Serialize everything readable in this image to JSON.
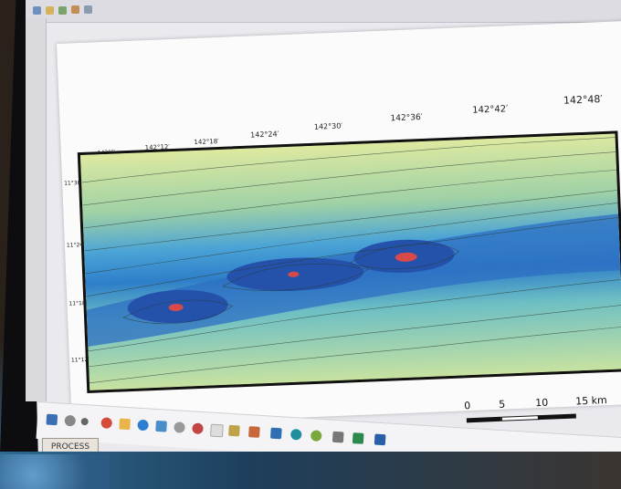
{
  "longitude_labels": [
    "142°6′",
    "142°12′",
    "142°18′",
    "142°24′",
    "142°30′",
    "142°36′",
    "142°42′",
    "142°48′"
  ],
  "latitude_labels": [
    "11°30′",
    "11°24′",
    "11°18′",
    "11°12′"
  ],
  "scale_bar": {
    "ticks": [
      "0",
      "5",
      "10",
      "15 km"
    ]
  },
  "label_text": "PROCESS",
  "colors": {
    "map_low": "#1f56b0",
    "map_mid": "#2f86d0",
    "map_high": "#d7e9a3",
    "hotspot": "#d84a4a"
  },
  "icons": [
    "save-icon",
    "folder-icon",
    "cursor-icon",
    "layers-icon",
    "pan-icon",
    "start-icon",
    "search-icon",
    "task-view-icon",
    "chrome-icon",
    "folder-icon",
    "browser-icon",
    "cloud-icon",
    "network-icon",
    "document-icon",
    "app-icon",
    "mail-icon",
    "map-app-icon",
    "qgis-icon",
    "files-icon",
    "excel-icon",
    "word-icon"
  ]
}
